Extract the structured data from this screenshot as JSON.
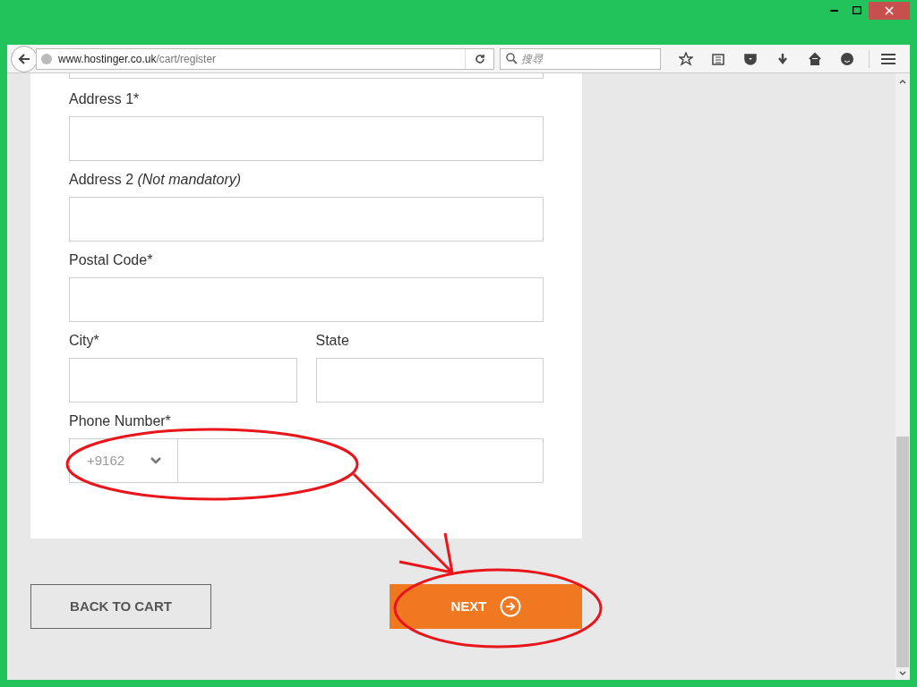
{
  "browser": {
    "url_host": "www.hostinger.co.uk",
    "url_path": "/cart/register",
    "search": {
      "placeholder": "搜尋"
    }
  },
  "form": {
    "fields": [
      {
        "kind": "single",
        "label": "Address 1*"
      },
      {
        "kind": "single",
        "label": "Address 2 *(Not mandatory)*"
      },
      {
        "kind": "single",
        "label": "Postal Code*"
      },
      {
        "kind": "pair",
        "items": [
          {
            "label": "City*"
          },
          {
            "label": "State"
          }
        ]
      },
      {
        "kind": "phone",
        "label": "Phone Number*",
        "code": "+9162"
      }
    ]
  },
  "buttons": {
    "back": "BACK TO CART",
    "next": "NEXT"
  }
}
